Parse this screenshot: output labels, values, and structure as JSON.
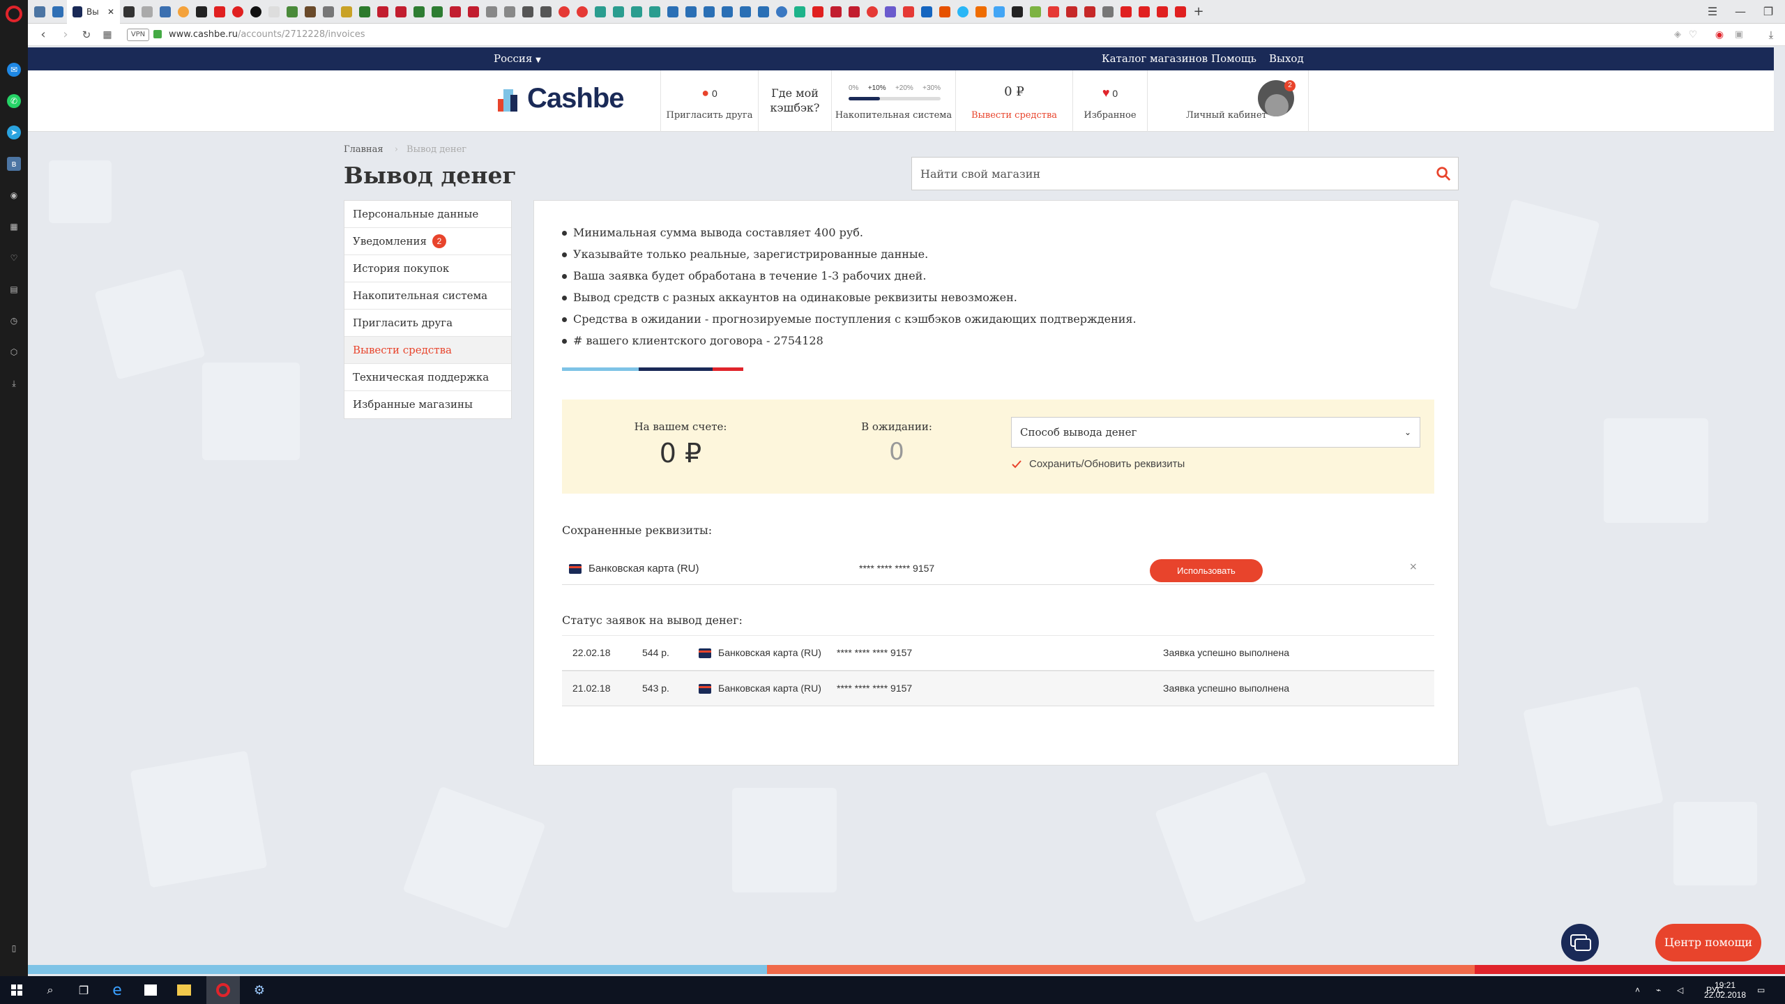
{
  "browser": {
    "active_tab_title": "Вы",
    "url_host": "www.cashbe.ru",
    "url_path": "/accounts/2712228/invoices",
    "vpn_label": "VPN",
    "new_tab": "+"
  },
  "topnav": {
    "country": "Россия",
    "links": [
      "Каталог магазинов",
      "Помощь",
      "Выход"
    ]
  },
  "header": {
    "logo_text": "Cashbe",
    "invite": {
      "count": "0",
      "label": "Пригласить друга"
    },
    "where_cashback": {
      "line1": "Где мой",
      "line2": "кэшбэк?"
    },
    "accum": {
      "ticks": [
        "0%",
        "+10%",
        "+20%",
        "+30%"
      ],
      "label": "Накопительная система"
    },
    "withdraw": {
      "amount": "0 ₽",
      "label": "Вывести средства"
    },
    "favorites": {
      "count": "0",
      "label": "Избранное"
    },
    "account": {
      "label": "Личный кабинет",
      "badge": "2"
    }
  },
  "breadcrumbs": {
    "home": "Главная",
    "current": "Вывод денег"
  },
  "page_title": "Вывод денег",
  "search": {
    "placeholder": "Найти свой магазин"
  },
  "sidebar": {
    "items": [
      {
        "label": "Персональные данные"
      },
      {
        "label": "Уведомления",
        "badge": "2"
      },
      {
        "label": "История покупок"
      },
      {
        "label": "Накопительная система"
      },
      {
        "label": "Пригласить друга"
      },
      {
        "label": "Вывести средства",
        "active": true
      },
      {
        "label": "Техническая поддержка"
      },
      {
        "label": "Избранные магазины"
      }
    ]
  },
  "notes": [
    "Минимальная сумма вывода составляет 400 руб.",
    "Указывайте только реальные, зарегистрированные данные.",
    "Ваша заявка будет обработана в течение 1-3 рабочих дней.",
    "Вывод средств с разных аккаунтов на одинаковые реквизиты невозможен.",
    "Средства в ожидании - прогнозируемые поступления с кэшбэков ожидающих подтверждения.",
    "# вашего клиентского договора - 2754128"
  ],
  "balance": {
    "account_label": "На вашем счете:",
    "account_value": "0 ₽",
    "pending_label": "В ожидании:",
    "pending_value": "0",
    "method_select": "Способ вывода денег",
    "save_checkbox": "Сохранить/Обновить реквизиты",
    "save_checked": true
  },
  "saved": {
    "title": "Сохраненные реквизиты:",
    "method": "Банковская карта (RU)",
    "number": "**** **** **** 9157",
    "use_label": "Использовать",
    "remove": "×"
  },
  "history": {
    "title": "Статус заявок на вывод денег:",
    "rows": [
      {
        "date": "22.02.18",
        "amount": "544 р.",
        "method": "Банковская карта (RU)",
        "number": "**** **** **** 9157",
        "status": "Заявка успешно выполнена"
      },
      {
        "date": "21.02.18",
        "amount": "543 р.",
        "method": "Банковская карта (RU)",
        "number": "**** **** **** 9157",
        "status": "Заявка успешно выполнена"
      }
    ]
  },
  "help": {
    "label": "Центр помощи"
  },
  "taskbar": {
    "lang": "РУС",
    "time": "19:21",
    "date": "22.02.2018"
  },
  "colors": {
    "navy": "#1a2a57",
    "accent": "#e8442c",
    "light_blue": "#7ec3e6",
    "red": "#e0242b"
  }
}
